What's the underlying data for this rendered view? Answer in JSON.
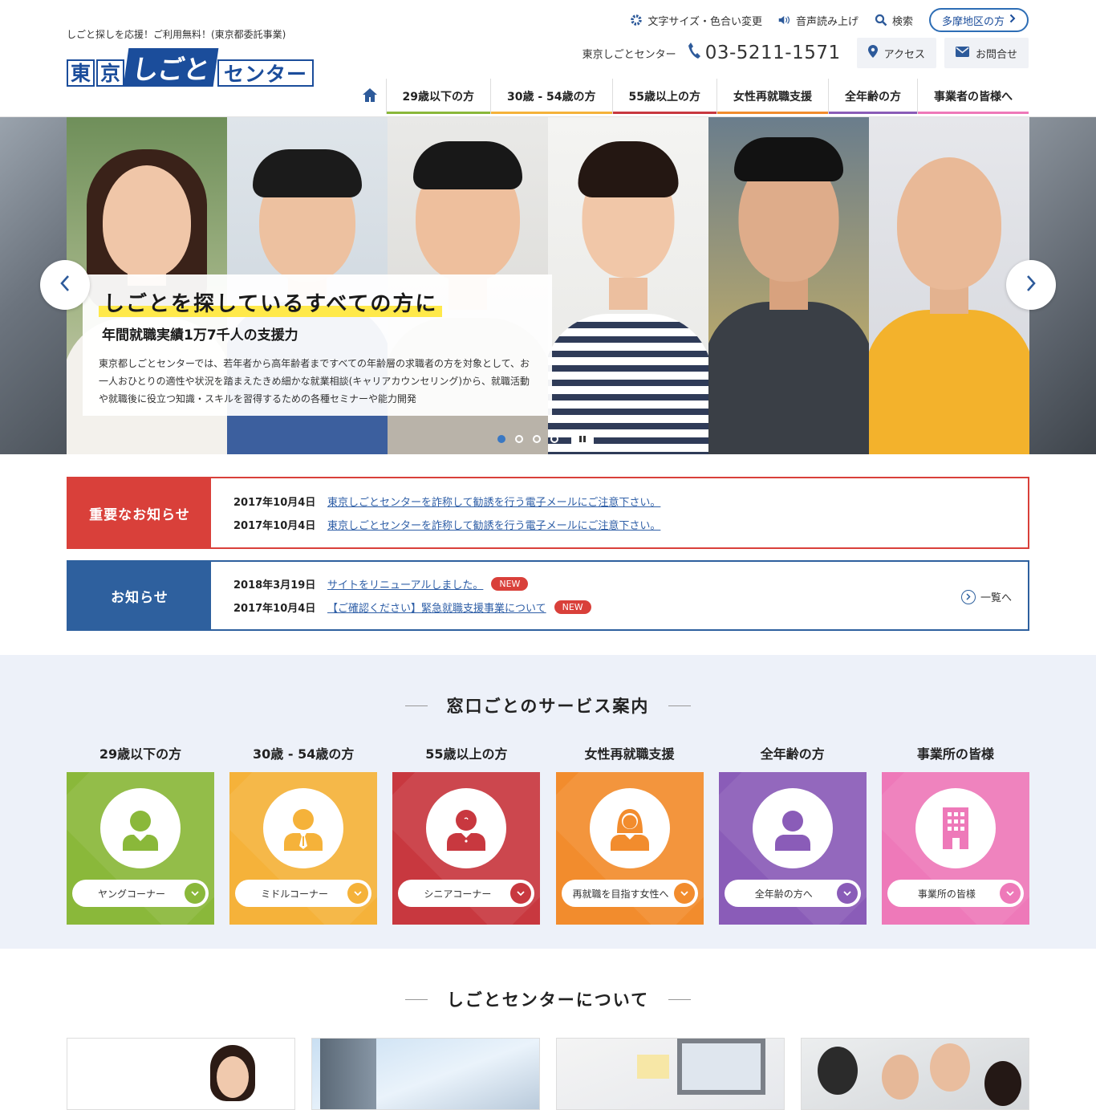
{
  "header": {
    "tagline": "しごと探しを応援！ご利用無料！(東京都委託事業)",
    "logo": {
      "box1": "東",
      "box2": "京",
      "shigoto": "しごと",
      "center": "センター"
    },
    "util": {
      "font_color": "文字サイズ・色合い変更",
      "voice": "音声読み上げ",
      "search": "検索",
      "tama": "多摩地区の方"
    },
    "center_name": "東京しごとセンター",
    "phone": "03-5211-1571",
    "access": "アクセス",
    "contact": "お問合せ",
    "nav": [
      {
        "label": "29歳以下の方",
        "color": "#8ab83a"
      },
      {
        "label": "30歳 - 54歳の方",
        "color": "#f5b23a"
      },
      {
        "label": "55歳以上の方",
        "color": "#c8383f"
      },
      {
        "label": "女性再就職支援",
        "color": "#f28c2d"
      },
      {
        "label": "全年齢の方",
        "color": "#8a5cb8"
      },
      {
        "label": "事業者の皆様へ",
        "color": "#ee79b9"
      }
    ]
  },
  "hero": {
    "title": "しごとを探しているすべての方に",
    "subtitle": "年間就職実績1万7千人の支援力",
    "text": "東京都しごとセンターでは、若年者から高年齢者まですべての年齢層の求職者の方を対象として、お一人おひとりの適性や状況を踏まえたきめ細かな就業相談(キャリアカウンセリング)から、就職活動や就職後に役立つ知識・スキルを習得するための各種セミナーや能力開発"
  },
  "notices": {
    "important": {
      "label": "重要なお知らせ",
      "items": [
        {
          "date": "2017年10月4日",
          "text": "東京しごとセンターを詐称して勧誘を行う電子メールにご注意下さい。"
        },
        {
          "date": "2017年10月4日",
          "text": "東京しごとセンターを詐称して勧誘を行う電子メールにご注意下さい。"
        }
      ]
    },
    "info": {
      "label": "お知らせ",
      "items": [
        {
          "date": "2018年3月19日",
          "text": "サイトをリニューアルしました。",
          "badge": "NEW"
        },
        {
          "date": "2017年10月4日",
          "text": "【ご確認ください】緊急就職支援事業について",
          "badge": "NEW"
        }
      ],
      "list_link": "一覧へ"
    }
  },
  "services": {
    "title": "窓口ごとのサービス案内",
    "items": [
      {
        "name": "29歳以下の方",
        "pill": "ヤングコーナー",
        "color": "#8ab83a",
        "icon": "person-icon"
      },
      {
        "name": "30歳 - 54歳の方",
        "pill": "ミドルコーナー",
        "color": "#f5b23a",
        "icon": "businessman-icon"
      },
      {
        "name": "55歳以上の方",
        "pill": "シニアコーナー",
        "color": "#c8383f",
        "icon": "senior-icon"
      },
      {
        "name": "女性再就職支援",
        "pill": "再就職を目指す女性へ",
        "color": "#f28c2d",
        "icon": "woman-icon"
      },
      {
        "name": "全年齢の方",
        "pill": "全年齢の方へ",
        "color": "#8a5cb8",
        "icon": "person-icon"
      },
      {
        "name": "事業所の皆様",
        "pill": "事業所の皆様",
        "color": "#ee79b9",
        "icon": "building-icon"
      }
    ]
  },
  "about": {
    "title": "しごとセンターについて"
  }
}
